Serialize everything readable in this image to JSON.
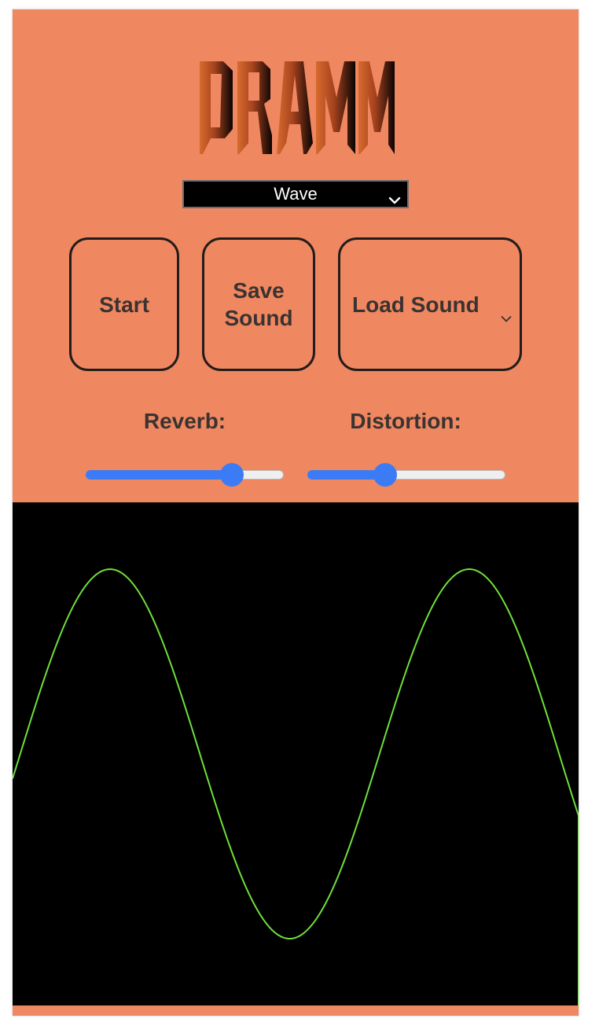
{
  "app": {
    "logo_text": "DRAMM"
  },
  "controls": {
    "wave_select": {
      "selected": "Wave",
      "icon": "chevron-down-icon"
    },
    "buttons": {
      "start_label": "Start",
      "save_label": "Save Sound",
      "load_label": "Load Sound",
      "load_icon": "chevron-down-icon"
    }
  },
  "effects": {
    "reverb": {
      "label": "Reverb:",
      "value": 0.77
    },
    "distortion": {
      "label": "Distortion:",
      "value": 0.38
    }
  },
  "visualizer": {
    "background": "#000000",
    "line_color": "#6ee03a"
  },
  "colors": {
    "background": "#ef8760",
    "accent": "#3b7cf6",
    "button_border": "#221c1a",
    "text": "#3a3331"
  }
}
